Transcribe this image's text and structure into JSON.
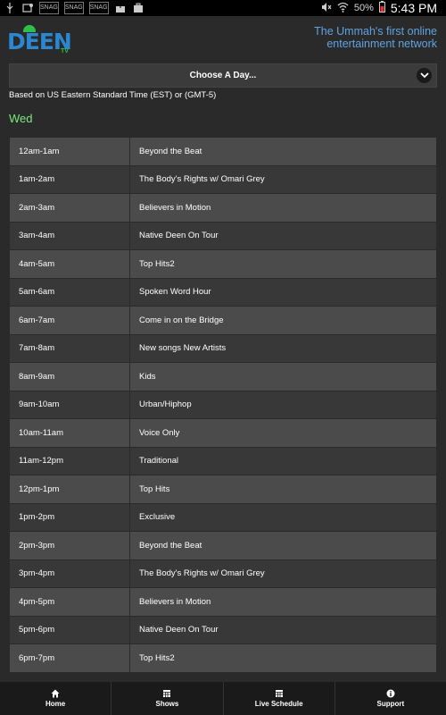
{
  "status_bar": {
    "left_icons": [
      "usb-icon",
      "notification-icon",
      "snag-1",
      "snag-2",
      "snag-3",
      "upload-icon",
      "briefcase-icon"
    ],
    "snag_label": "SNAG",
    "battery": "50%",
    "time": "5:43 PM"
  },
  "header": {
    "logo_text": "DEEN",
    "logo_tv": "TV",
    "tagline_line1": "The Ummah's first online",
    "tagline_line2": "entertainment network"
  },
  "day_select": {
    "label": "Choose A Day..."
  },
  "timezone_note": "Based on US Eastern Standard Time (EST) or (GMT-5)",
  "day_title": "Wed",
  "schedule": [
    {
      "time": "12am-1am",
      "show": "Beyond the Beat"
    },
    {
      "time": "1am-2am",
      "show": "The Body's Rights w/ Omari Grey"
    },
    {
      "time": "2am-3am",
      "show": "Believers in Motion"
    },
    {
      "time": "3am-4am",
      "show": "Native Deen On Tour"
    },
    {
      "time": "4am-5am",
      "show": "Top Hits2"
    },
    {
      "time": "5am-6am",
      "show": "Spoken Word Hour"
    },
    {
      "time": "6am-7am",
      "show": "Come in on the Bridge"
    },
    {
      "time": "7am-8am",
      "show": "New songs New Artists"
    },
    {
      "time": "8am-9am",
      "show": "Kids"
    },
    {
      "time": "9am-10am",
      "show": "Urban/Hiphop"
    },
    {
      "time": "10am-11am",
      "show": "Voice Only"
    },
    {
      "time": "11am-12pm",
      "show": "Traditional"
    },
    {
      "time": "12pm-1pm",
      "show": "Top Hits"
    },
    {
      "time": "1pm-2pm",
      "show": "Exclusive"
    },
    {
      "time": "2pm-3pm",
      "show": "Beyond the Beat"
    },
    {
      "time": "3pm-4pm",
      "show": "The Body's Rights w/ Omari Grey"
    },
    {
      "time": "4pm-5pm",
      "show": "Believers in Motion"
    },
    {
      "time": "5pm-6pm",
      "show": "Native Deen On Tour"
    },
    {
      "time": "6pm-7pm",
      "show": "Top Hits2"
    }
  ],
  "nav": [
    {
      "label": "Home",
      "icon": "home-icon"
    },
    {
      "label": "Shows",
      "icon": "shows-icon"
    },
    {
      "label": "Live Schedule",
      "icon": "calendar-icon"
    },
    {
      "label": "Support",
      "icon": "info-icon"
    }
  ],
  "colors": {
    "background": "#2a2a2a",
    "row_odd": "#4b4b4b",
    "row_even": "#383838",
    "accent_blue": "#2a87d0",
    "accent_green": "#7de87d"
  }
}
